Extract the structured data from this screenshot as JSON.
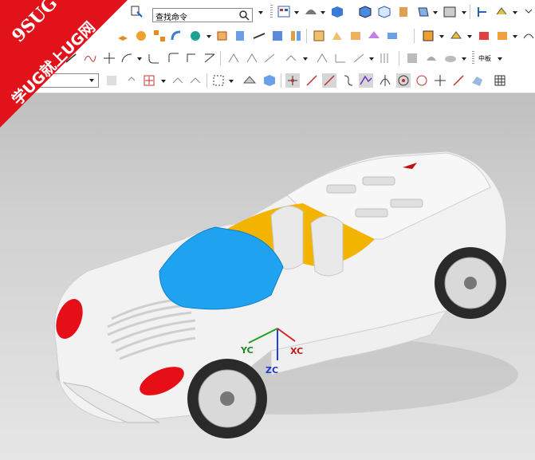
{
  "watermark": {
    "line1": "9SUG",
    "line2": "学UG就上UG网"
  },
  "toolbar": {
    "search_placeholder": "查找命令",
    "row3_text": "中板",
    "selection_filter_value": ""
  },
  "viewport": {
    "axes": {
      "x": "XC",
      "y": "YC",
      "z": "ZC"
    },
    "car_body_color": "#f2f2f2",
    "windshield_color": "#1fa3f0",
    "light_color": "#e60f18",
    "interior_color": "#f3b400"
  },
  "colors": {
    "accent": "#e2121a",
    "background_top": "#bfbfbf",
    "background_bottom": "#e6e6e6"
  }
}
